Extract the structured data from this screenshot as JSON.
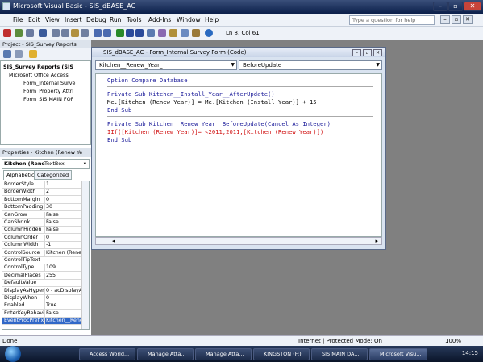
{
  "window": {
    "title": "Microsoft Visual Basic - SIS_dBASE_AC"
  },
  "menu": {
    "items": [
      "File",
      "Edit",
      "View",
      "Insert",
      "Debug",
      "Run",
      "Tools",
      "Add-Ins",
      "Window",
      "Help"
    ]
  },
  "ask_question": {
    "placeholder": "Type a question for help"
  },
  "toolbar": {
    "position": "Ln 8, Col 61"
  },
  "project": {
    "title": "Project - SIS_Survey Reports",
    "tree": [
      "SIS_Survey Reports (SIS",
      "Microsoft Office Access",
      "Form_Internal Surve",
      "Form_Property Attri",
      "Form_SIS MAIN FOF"
    ]
  },
  "properties": {
    "title": "Properties - Kitchen (Renew Ye",
    "object": "Kitchen (Rene",
    "object_type": "TextBox",
    "tabs": [
      "Alphabetic",
      "Categorized"
    ],
    "rows": [
      {
        "name": "BorderStyle",
        "value": "1"
      },
      {
        "name": "BorderWidth",
        "value": "2"
      },
      {
        "name": "BottomMargin",
        "value": "0"
      },
      {
        "name": "BottomPadding",
        "value": "30"
      },
      {
        "name": "CanGrow",
        "value": "False"
      },
      {
        "name": "CanShrink",
        "value": "False"
      },
      {
        "name": "ColumnHidden",
        "value": "False"
      },
      {
        "name": "ColumnOrder",
        "value": "0"
      },
      {
        "name": "ColumnWidth",
        "value": "-1"
      },
      {
        "name": "ControlSource",
        "value": "Kitchen (Rene"
      },
      {
        "name": "ControlTipText",
        "value": ""
      },
      {
        "name": "ControlType",
        "value": "109"
      },
      {
        "name": "DecimalPlaces",
        "value": "255"
      },
      {
        "name": "DefaultValue",
        "value": ""
      },
      {
        "name": "DisplayAsHyperl",
        "value": "0 - acDisplayA"
      },
      {
        "name": "DisplayWhen",
        "value": "0"
      },
      {
        "name": "Enabled",
        "value": "True"
      },
      {
        "name": "EnterKeyBehavi",
        "value": "False"
      },
      {
        "name": "EventProcPrefix",
        "value": "Kitchen__Rene"
      }
    ]
  },
  "code_window": {
    "title": "SIS_dBASE_AC - Form_Internal Survey Form (Code)",
    "object_combo": "Kitchen__Renew_Year_",
    "proc_combo": "BeforeUpdate",
    "lines": {
      "l1": "Option Compare Database",
      "l2": "Private Sub Kitchen__Install_Year__AfterUpdate()",
      "l3": "Me.[Kitchen (Renew Year)] = Me.[Kitchen (Install Year)] + 15",
      "l4": "End Sub",
      "l5": "Private Sub Kitchen__Renew_Year__BeforeUpdate(Cancel As Integer)",
      "l6": "IIf([Kitchen (Renew Year)]= <2011,2011,[Kitchen (Renew Year)])",
      "l7": "End Sub"
    }
  },
  "status": {
    "left": "Done",
    "zone": "Internet | Protected Mode: On",
    "zoom": "100%"
  },
  "taskbar": {
    "tasks": [
      "Access World...",
      "Manage Atta...",
      "Manage Atta...",
      "KINGSTON (F:)",
      "SIS MAIN DA...",
      "Microsoft Visu..."
    ],
    "clock": "14:15"
  },
  "colors": {
    "keyword": "#1a1a99",
    "error": "#d01010",
    "title_bar": "#0b1f4a"
  }
}
